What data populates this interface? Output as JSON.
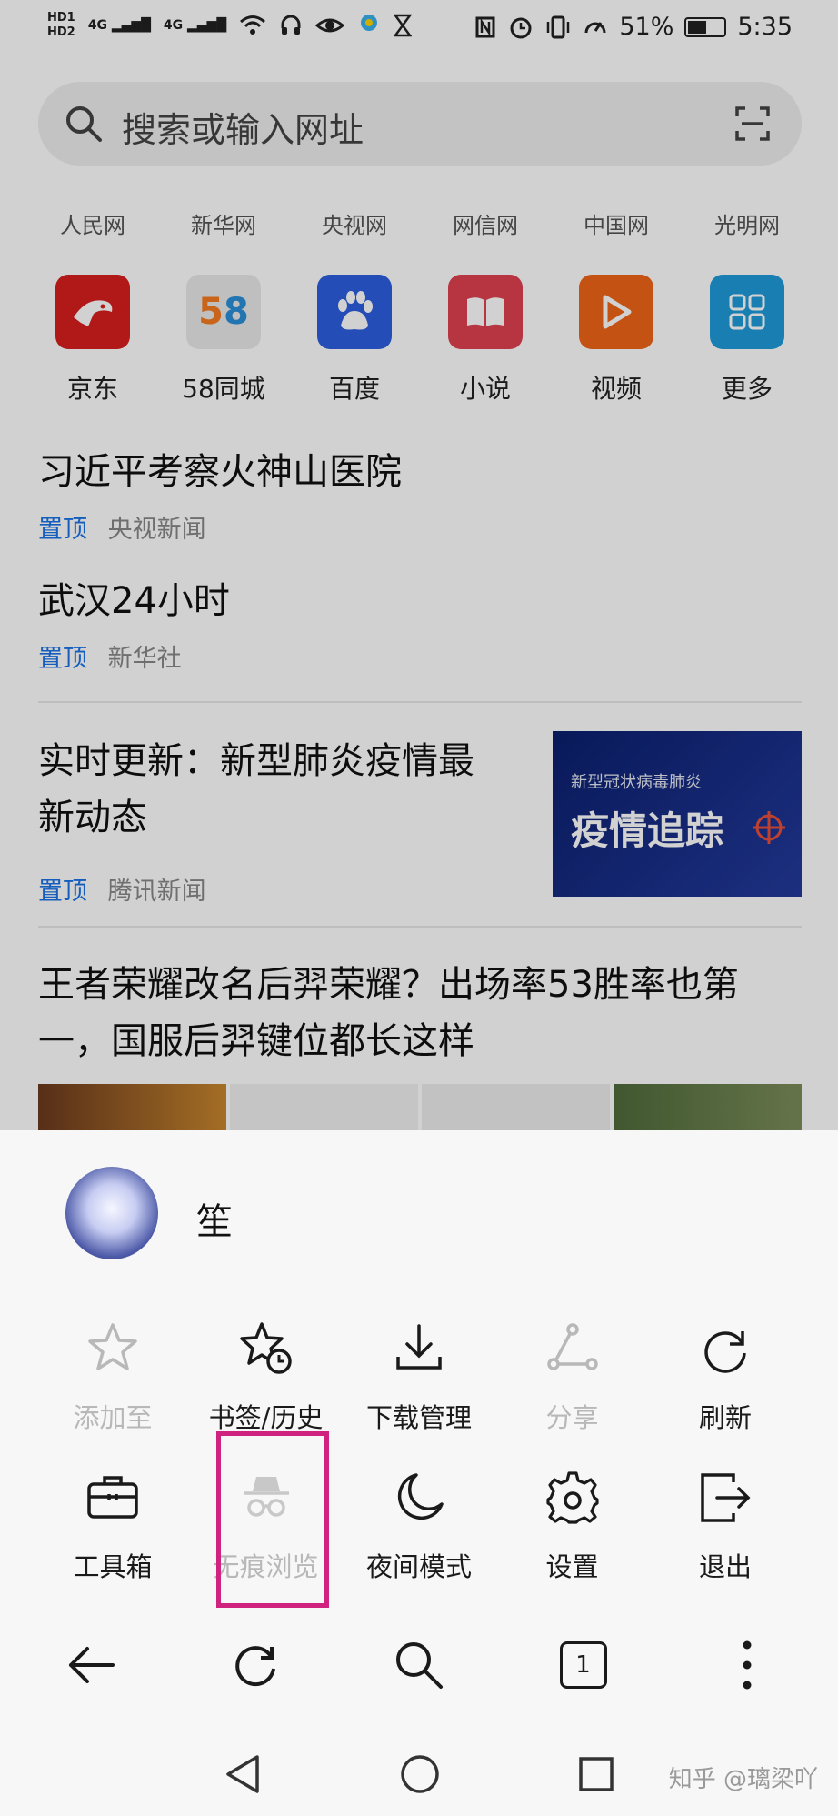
{
  "status_bar": {
    "hd_labels": [
      "HD1",
      "HD2"
    ],
    "signal_labels": [
      "4G",
      "4G"
    ],
    "battery_percent": "51%",
    "battery_level": 0.51,
    "time": "5:35"
  },
  "search": {
    "placeholder": "搜索或输入网址"
  },
  "quick_links": [
    "人民网",
    "新华网",
    "央视网",
    "网信网",
    "中国网",
    "光明网"
  ],
  "apps": [
    {
      "label": "京东",
      "icon": "jd-dog-icon",
      "color": "#d81e1e"
    },
    {
      "label": "58同城",
      "icon": "58-logo-icon",
      "color": "#eaeaea"
    },
    {
      "label": "百度",
      "icon": "baidu-paw-icon",
      "color": "#2d5fe0"
    },
    {
      "label": "小说",
      "icon": "book-icon",
      "color": "#e04050"
    },
    {
      "label": "视频",
      "icon": "play-icon",
      "color": "#f06418"
    },
    {
      "label": "更多",
      "icon": "grid-icon",
      "color": "#1f9ad8"
    }
  ],
  "news": [
    {
      "title": "习近平考察火神山医院",
      "pin": "置顶",
      "source": "央视新闻"
    },
    {
      "title": "武汉24小时",
      "pin": "置顶",
      "source": "新华社"
    },
    {
      "title_line1": "实时更新：新型肺炎疫情最",
      "title_line2": "新动态",
      "pin": "置顶",
      "source": "腾讯新闻",
      "thumb_small": "新型冠状病毒肺炎",
      "thumb_big": "疫情追踪"
    },
    {
      "title_line1": "王者荣耀改名后羿荣耀？出场率53胜率也第",
      "title_line2": "一，国服后羿键位都长这样"
    }
  ],
  "sheet": {
    "username": "笙",
    "row1": [
      {
        "label": "添加至",
        "icon": "star-icon",
        "disabled": true
      },
      {
        "label": "书签/历史",
        "icon": "bookmark-history-icon",
        "disabled": false
      },
      {
        "label": "下载管理",
        "icon": "download-icon",
        "disabled": false
      },
      {
        "label": "分享",
        "icon": "share-icon",
        "disabled": true
      },
      {
        "label": "刷新",
        "icon": "refresh-icon",
        "disabled": false
      }
    ],
    "row2": [
      {
        "label": "工具箱",
        "icon": "toolbox-icon",
        "disabled": false
      },
      {
        "label": "无痕浏览",
        "icon": "incognito-icon",
        "disabled": true
      },
      {
        "label": "夜间模式",
        "icon": "moon-icon",
        "disabled": false
      },
      {
        "label": "设置",
        "icon": "gear-icon",
        "disabled": false
      },
      {
        "label": "退出",
        "icon": "exit-icon",
        "disabled": false
      }
    ]
  },
  "browser_nav": {
    "tab_count": "1"
  },
  "watermark": "知乎 @璃梁吖",
  "colors": {
    "accent_pin": "#1a73e8",
    "highlight_box": "#d0237f"
  }
}
